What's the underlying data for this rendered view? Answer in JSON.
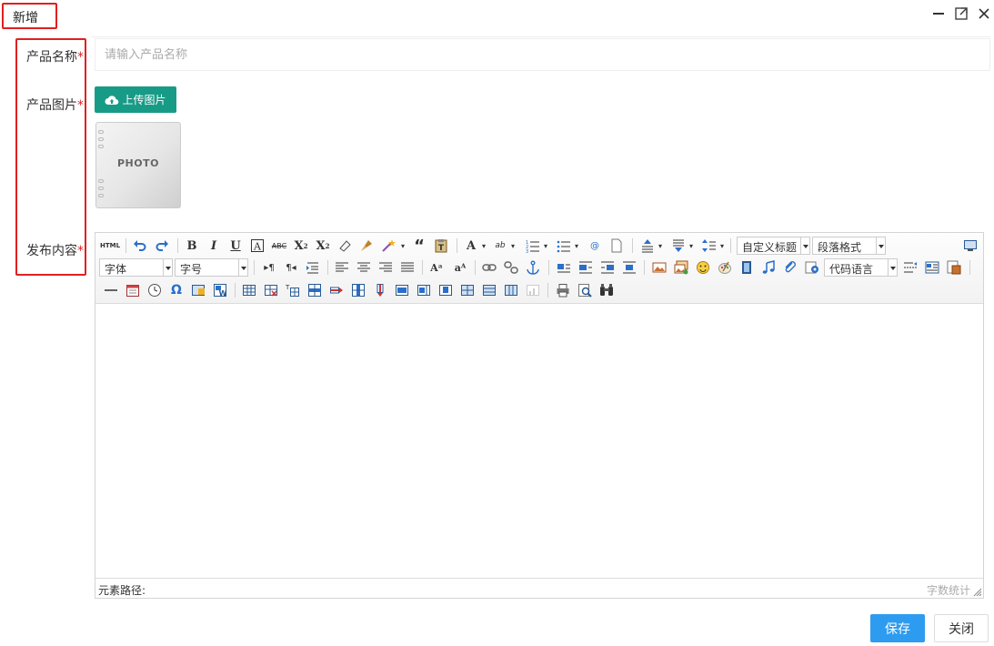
{
  "dialog": {
    "title": "新增",
    "minimize_icon": "minimize-icon",
    "maximize_icon": "maximize-icon",
    "close_icon": "close-icon"
  },
  "form": {
    "name_label": "产品名称",
    "image_label": "产品图片",
    "content_label": "发布内容",
    "required_mark": "*",
    "name_placeholder": "请输入产品名称",
    "name_value": "",
    "upload_button": "上传图片",
    "photo_placeholder_text": "PHOTO"
  },
  "editor": {
    "html_button": "HTML",
    "custom_title_select": "自定义标题",
    "paragraph_select": "段落格式",
    "font_family_select": "字体",
    "font_size_select": "字号",
    "code_language_select": "代码语言",
    "element_path_label": "元素路径:",
    "word_count_label": "字数统计"
  },
  "footer": {
    "save_button": "保存",
    "close_button": "关闭"
  },
  "colors": {
    "accent_red": "#e02020",
    "upload_green": "#179b87",
    "save_blue": "#2d9bf0"
  }
}
